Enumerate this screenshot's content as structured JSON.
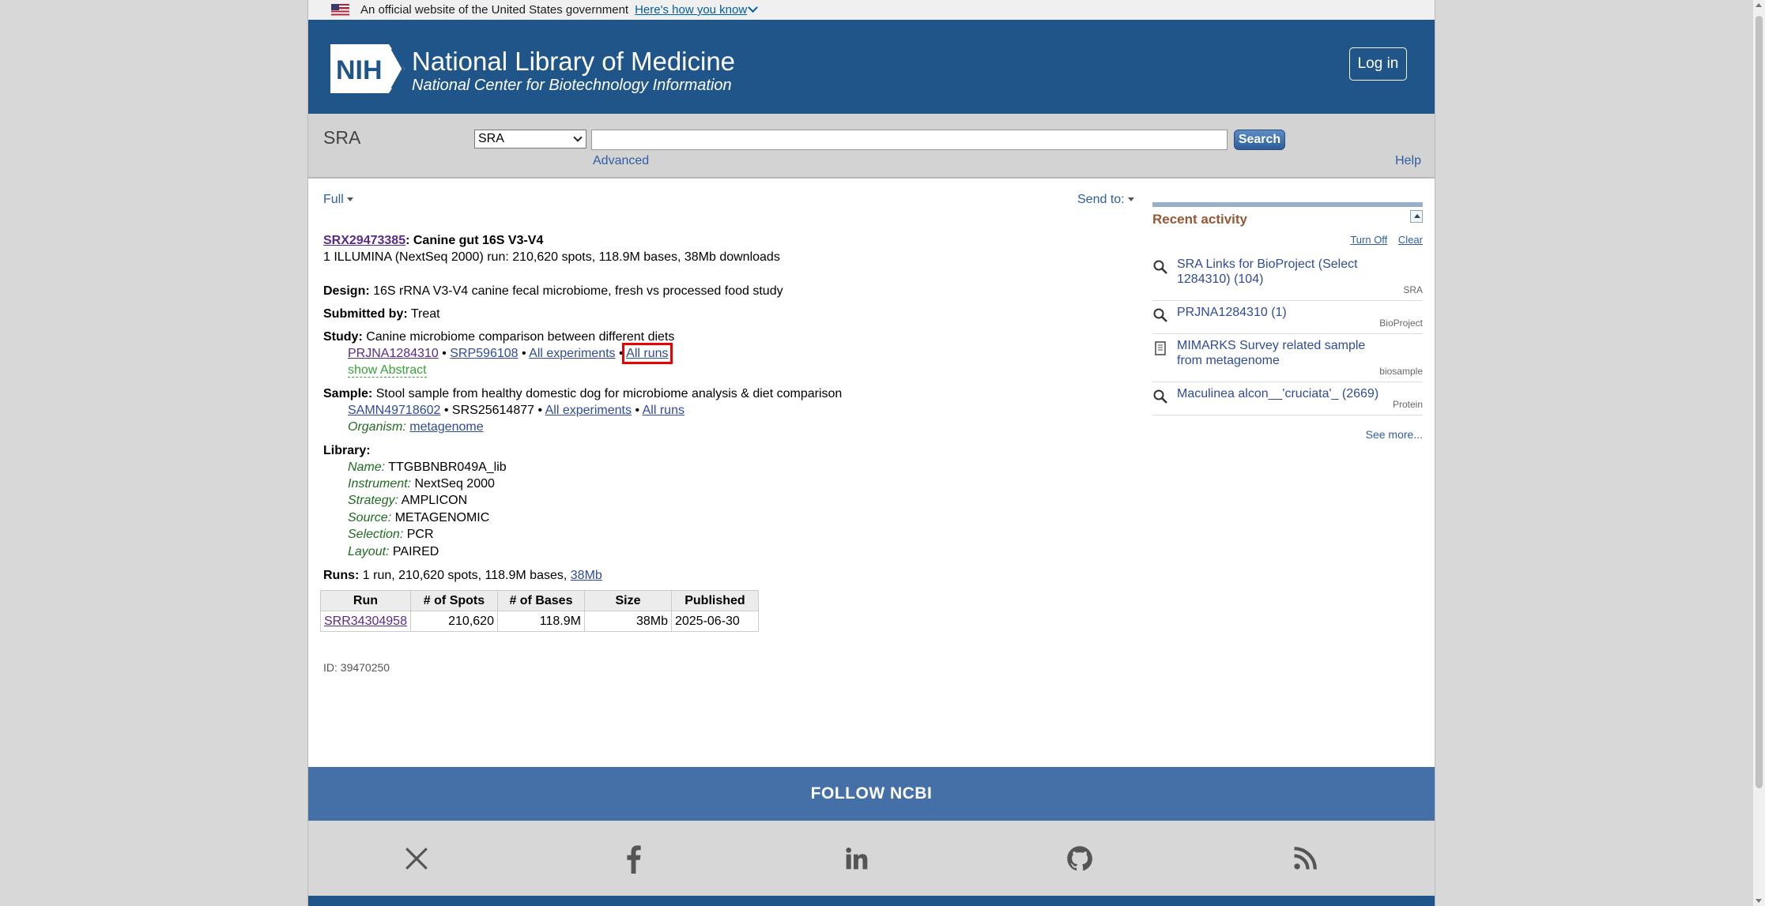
{
  "gov_banner": {
    "text": "An official website of the United States government",
    "link": "Here's how you know"
  },
  "header": {
    "logo_text": "NIH",
    "title": "National Library of Medicine",
    "subtitle": "National Center for Biotechnology Information",
    "login": "Log in"
  },
  "search": {
    "db_label": "SRA",
    "db_selected": "SRA",
    "query": "",
    "button": "Search",
    "advanced": "Advanced",
    "help": "Help"
  },
  "toolbar": {
    "format": "Full",
    "send_to": "Send to:"
  },
  "record": {
    "accession": "SRX29473385",
    "title": ": Canine gut 16S V3-V4",
    "summary": "1 ILLUMINA (NextSeq 2000) run: 210,620 spots, 118.9M bases, 38Mb downloads",
    "design_label": "Design:",
    "design": " 16S rRNA V3-V4 canine fecal microbiome, fresh vs processed food study",
    "submitted_label": "Submitted by:",
    "submitted": " Treat",
    "study_label": "Study:",
    "study": " Canine microbiome comparison between different diets",
    "study_links": {
      "bioproject": "PRJNA1284310",
      "srp": "SRP596108",
      "sep": " • ",
      "all_experiments": "All experiments",
      "all_runs": "All runs"
    },
    "show_abstract": "show Abstract",
    "sample_label": "Sample:",
    "sample": " Stool sample from healthy domestic dog for microbiome analysis & diet comparison",
    "sample_links": {
      "biosample": "SAMN49718602",
      "srs": "SRS25614877",
      "sep": " • ",
      "all_experiments": "All experiments",
      "all_runs": "All runs"
    },
    "organism_label": "Organism:",
    "organism": "metagenome",
    "library_label": "Library:",
    "library": [
      {
        "key": "Name:",
        "value": " TTGBBNBR049A_lib"
      },
      {
        "key": "Instrument:",
        "value": " NextSeq 2000"
      },
      {
        "key": "Strategy:",
        "value": " AMPLICON"
      },
      {
        "key": "Source:",
        "value": " METAGENOMIC"
      },
      {
        "key": "Selection:",
        "value": " PCR"
      },
      {
        "key": "Layout:",
        "value": " PAIRED"
      }
    ],
    "runs_label": "Runs:",
    "runs_summary": " 1 run, 210,620 spots, 118.9M bases, ",
    "runs_size_link": "38Mb",
    "runs_table": {
      "headers": [
        "Run",
        "# of Spots",
        "# of Bases",
        "Size",
        "Published"
      ],
      "rows": [
        [
          "SRR34304958",
          "210,620",
          "118.9M",
          "38Mb",
          "2025-06-30"
        ]
      ]
    },
    "id": "ID: 39470250"
  },
  "sidebar": {
    "title": "Recent activity",
    "turn_off": "Turn Off",
    "clear": "Clear",
    "items": [
      {
        "text": "SRA Links for BioProject (Select 1284310) (104)",
        "db": "SRA",
        "icon": "search-icon"
      },
      {
        "text": "PRJNA1284310 (1)",
        "db": "BioProject",
        "icon": "search-icon"
      },
      {
        "text": "MIMARKS Survey related sample from metagenome",
        "db": "biosample",
        "icon": "document-icon"
      },
      {
        "text": "Maculinea alcon__'cruciata'_ (2669)",
        "db": "Protein",
        "icon": "search-icon"
      }
    ],
    "see_more": "See more..."
  },
  "footer": {
    "follow": "FOLLOW NCBI",
    "social": [
      "x-icon",
      "facebook-icon",
      "linkedin-icon",
      "github-icon",
      "rss-icon"
    ]
  },
  "colors": {
    "header_blue": "#20558a",
    "follow_blue": "#4470a7",
    "highlight_red": "#e00000",
    "recent_title": "#985735"
  }
}
